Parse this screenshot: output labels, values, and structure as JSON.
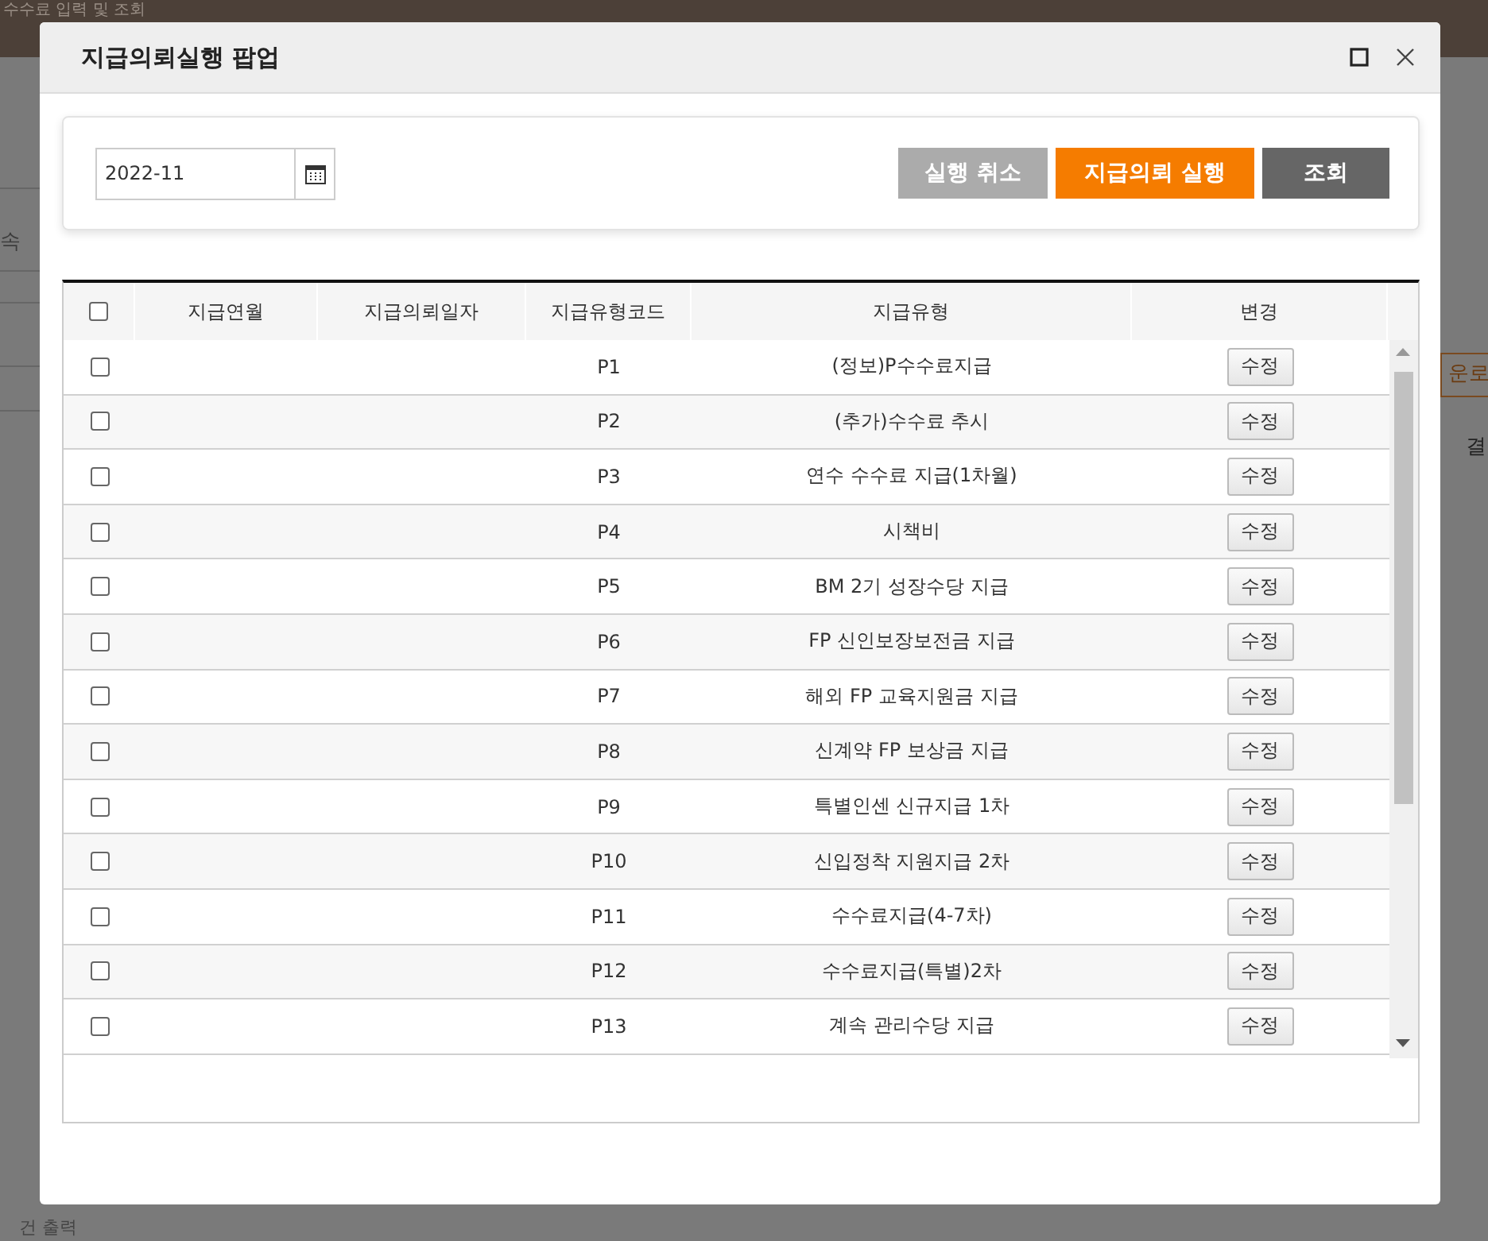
{
  "background": {
    "tab_title": "수수료 입력 및 조회",
    "left_label": "속",
    "download_button": "운로",
    "right_header": "결",
    "bottom_text": "건 출력"
  },
  "modal": {
    "title": "지급의뢰실행 팝업"
  },
  "filter": {
    "month": "2022-11"
  },
  "buttons": [
    {
      "kind": "cancel",
      "label": "실행 취소"
    },
    {
      "kind": "execute",
      "label": "지급의뢰 실행"
    },
    {
      "kind": "search",
      "label": "조회"
    }
  ],
  "table": {
    "select_all": {
      "checked": false
    },
    "columns": [
      "지급연월",
      "지급의뢰일자",
      "지급유형코드",
      "지급유형",
      "변경"
    ],
    "rows": [
      {
        "checked": false,
        "code": "P1",
        "type": "(정보)P수수료지급",
        "action": "수정"
      },
      {
        "checked": false,
        "code": "P2",
        "type": "(추가)수수료 추시",
        "action": "수정"
      },
      {
        "checked": false,
        "code": "P3",
        "type": "연수 수수료 지급(1차월)",
        "action": "수정"
      },
      {
        "checked": false,
        "code": "P4",
        "type": "시책비",
        "action": "수정"
      },
      {
        "checked": false,
        "code": "P5",
        "type": "BM 2기 성장수당 지급",
        "action": "수정"
      },
      {
        "checked": false,
        "code": "P6",
        "type": "FP 신인보장보전금 지급",
        "action": "수정"
      },
      {
        "checked": false,
        "code": "P7",
        "type": "해외 FP 교육지원금 지급",
        "action": "수정"
      },
      {
        "checked": false,
        "code": "P8",
        "type": "신계약 FP 보상금 지급",
        "action": "수정"
      },
      {
        "checked": false,
        "code": "P9",
        "type": "특별인센 신규지급 1차",
        "action": "수정"
      },
      {
        "checked": false,
        "code": "P10",
        "type": "신입정착 지원지급 2차",
        "action": "수정"
      },
      {
        "checked": false,
        "code": "P11",
        "type": "수수료지급(4-7차)",
        "action": "수정"
      },
      {
        "checked": false,
        "code": "P12",
        "type": "수수료지급(특별)2차",
        "action": "수정"
      },
      {
        "checked": false,
        "code": "P13",
        "type": "계속 관리수당 지급",
        "action": "수정"
      }
    ]
  }
}
